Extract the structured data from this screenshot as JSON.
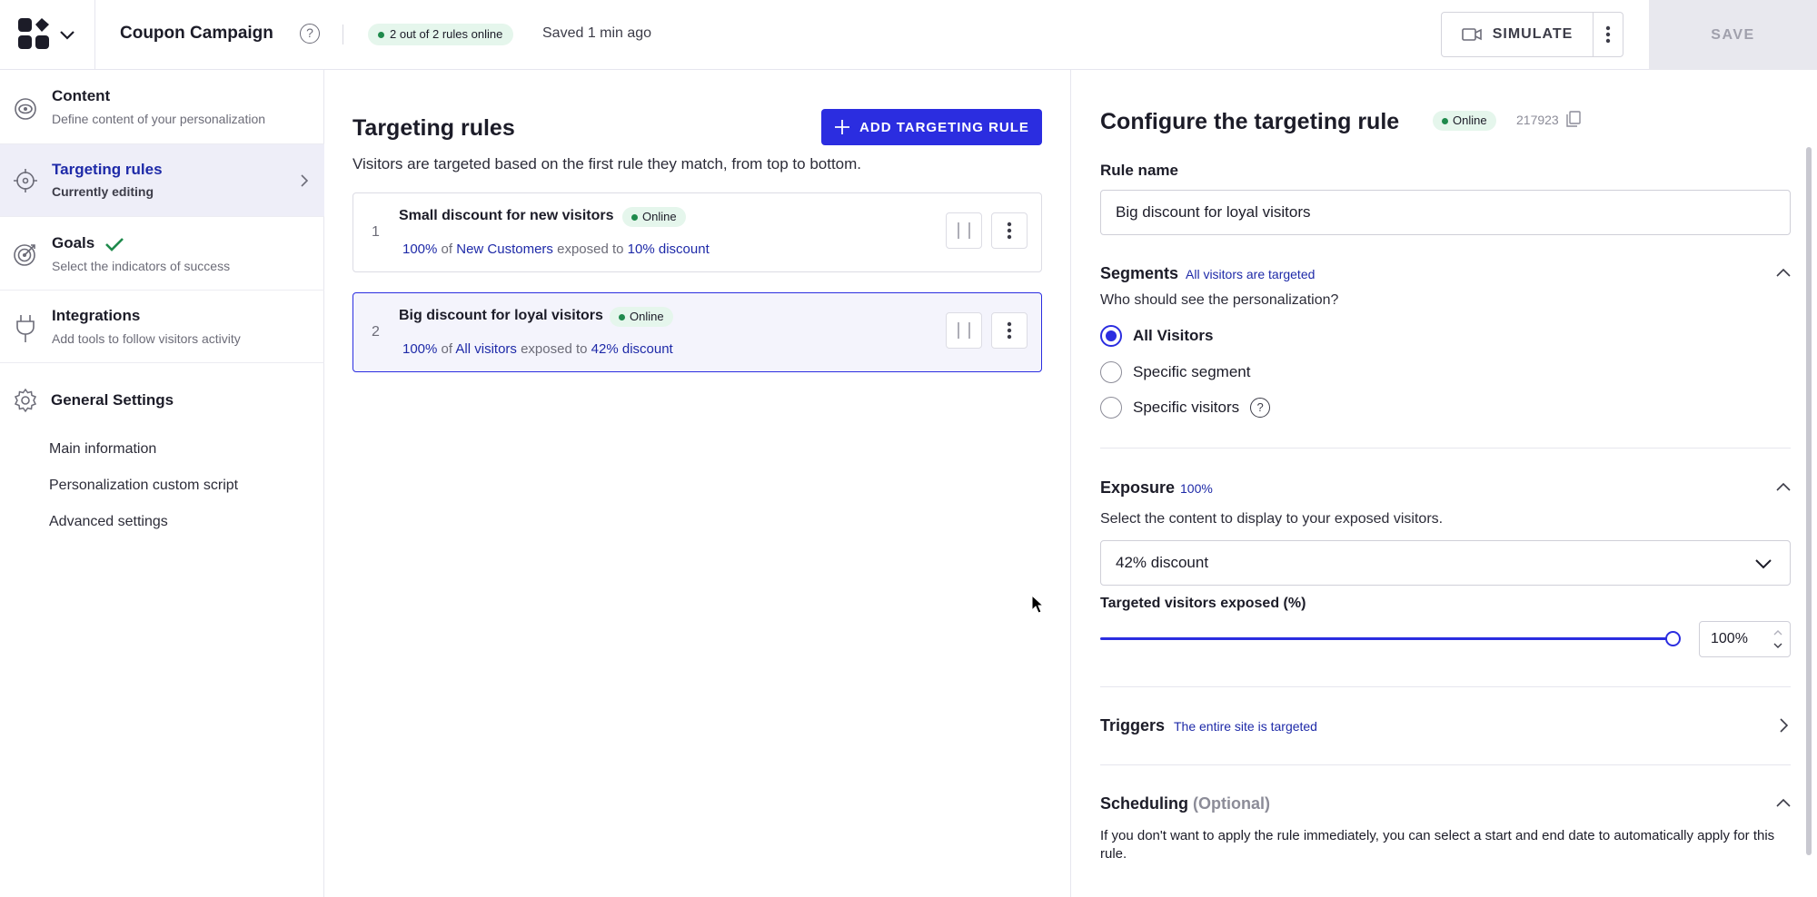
{
  "header": {
    "campaign_title": "Coupon Campaign",
    "help_glyph": "?",
    "rules_status": "2 out of 2 rules online",
    "saved_status": "Saved 1 min ago",
    "simulate_label": "SIMULATE",
    "save_label": "SAVE"
  },
  "sidebar": {
    "items": [
      {
        "title": "Content",
        "subtitle": "Define content of your personalization",
        "icon": "eye-target-icon"
      },
      {
        "title": "Targeting rules",
        "subtitle": "Currently editing",
        "icon": "crosshair-icon",
        "active": true
      },
      {
        "title": "Goals",
        "subtitle": "Select the indicators of success",
        "icon": "bullseye-icon",
        "done": true
      },
      {
        "title": "Integrations",
        "subtitle": "Add tools to follow visitors activity",
        "icon": "plug-icon"
      }
    ],
    "general_settings": {
      "title": "General Settings",
      "links": [
        "Main information",
        "Personalization custom script",
        "Advanced settings"
      ]
    }
  },
  "rules_panel": {
    "title": "Targeting rules",
    "add_button": "ADD TARGETING RULE",
    "description": "Visitors are targeted based on the first rule they match, from top to bottom.",
    "rules": [
      {
        "index": "1",
        "name": "Small discount for new visitors",
        "status": "Online",
        "percent": "100%",
        "of": "of",
        "audience": "New Customers",
        "exposed": "exposed to",
        "content": "10% discount"
      },
      {
        "index": "2",
        "name": "Big discount for loyal visitors",
        "status": "Online",
        "percent": "100%",
        "of": "of",
        "audience": "All visitors",
        "exposed": "exposed to",
        "content": "42% discount"
      }
    ]
  },
  "config": {
    "title": "Configure the targeting rule",
    "status": "Online",
    "rule_id": "217923",
    "rule_name_label": "Rule name",
    "rule_name_value": "Big discount for loyal visitors",
    "segments": {
      "label": "Segments",
      "hint": "All visitors are targeted",
      "question": "Who should see the personalization?",
      "options": [
        "All Visitors",
        "Specific segment",
        "Specific visitors"
      ],
      "selected": "All Visitors"
    },
    "exposure": {
      "label": "Exposure",
      "hint": "100%",
      "instruction": "Select the content to display to your exposed visitors.",
      "selected_content": "42% discount",
      "slider_label": "Targeted visitors exposed (%)",
      "slider_value": 1.0,
      "percent_value": "100%"
    },
    "triggers": {
      "label": "Triggers",
      "hint": "The entire site is targeted"
    },
    "scheduling": {
      "label": "Scheduling",
      "optional": "(Optional)",
      "description": "If you don't want to apply the rule immediately, you can select a start and end date to automatically apply for this rule."
    }
  },
  "colors": {
    "primary": "#2b2de0",
    "accent_text": "#1e2aa8",
    "online_bg": "#e5f6ec",
    "online_dot": "#1f8a4c"
  }
}
